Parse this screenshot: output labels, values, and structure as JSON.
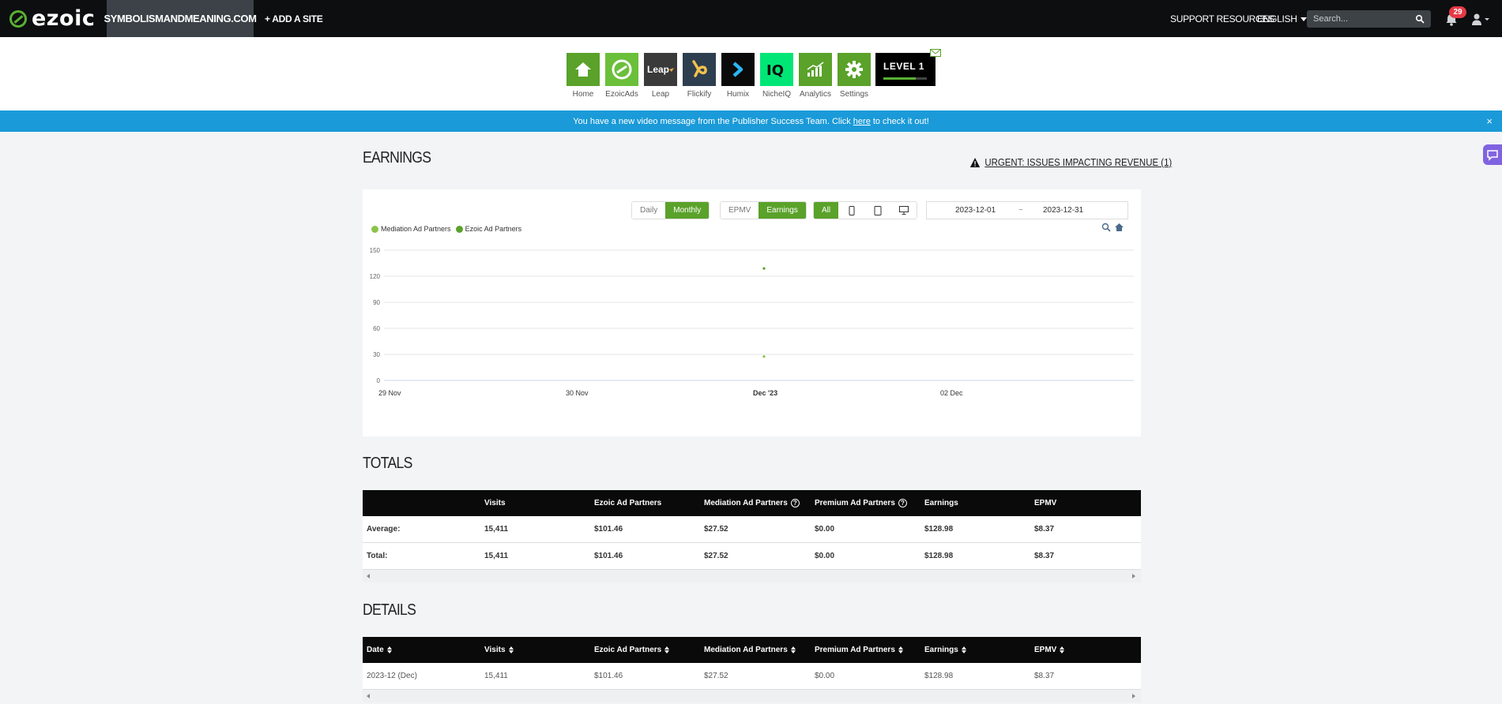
{
  "brand": {
    "name": "ezoic"
  },
  "topbar": {
    "site": "SYMBOLISMANDMEANING.COM",
    "add_site": "+ ADD A SITE",
    "support": "SUPPORT RESOURCES",
    "language": "ENGLISH",
    "search_placeholder": "Search...",
    "notification_count": "29"
  },
  "apps": [
    {
      "label": "Home",
      "color": "#5aa22a",
      "icon": "home-icon"
    },
    {
      "label": "EzoicAds",
      "color": "#5aa22a",
      "icon": "ezoicads-icon"
    },
    {
      "label": "Leap",
      "color": "#3a3a3a",
      "icon": "leap-icon"
    },
    {
      "label": "Flickify",
      "color": "#2d3e4f",
      "icon": "flickify-icon"
    },
    {
      "label": "Humix",
      "color": "#0a0a0a",
      "icon": "humix-icon"
    },
    {
      "label": "NicheIQ",
      "color": "#00e676",
      "icon": "nicheiq-icon"
    },
    {
      "label": "Analytics",
      "color": "#5aa22a",
      "icon": "analytics-icon"
    },
    {
      "label": "Settings",
      "color": "#5aa22a",
      "icon": "gear-icon"
    }
  ],
  "level": {
    "text": "LEVEL 1",
    "progress": 0.75
  },
  "banner": {
    "before": "You have a new video message from the Publisher Success Team. Click",
    "link": "here",
    "after": "to check it out!",
    "close": "×"
  },
  "earnings": {
    "title": "EARNINGS",
    "urgent": "URGENT: ISSUES IMPACTING REVENUE (1)",
    "period_buttons": [
      "Daily",
      "Monthly"
    ],
    "active_period": "Monthly",
    "metric_buttons": [
      "EPMV",
      "Earnings"
    ],
    "active_metric": "Earnings",
    "device_all": "All",
    "date_from": "2023-12-01",
    "date_sep": "~",
    "date_to": "2023-12-31"
  },
  "chart_data": {
    "type": "scatter",
    "x": [
      "29 Nov",
      "30 Nov",
      "Dec '23",
      "02 Dec"
    ],
    "series": [
      {
        "name": "Mediation Ad Partners",
        "color": "#8bc34a",
        "points": [
          {
            "x": "Dec '23",
            "y": 27.52
          }
        ]
      },
      {
        "name": "Ezoic Ad Partners",
        "color": "#5aa22a",
        "points": [
          {
            "x": "Dec '23",
            "y": 128.98
          }
        ]
      }
    ],
    "yticks": [
      0,
      30,
      60,
      90,
      120,
      150
    ],
    "ylim": [
      0,
      150
    ],
    "grid": true,
    "legend": "top-left"
  },
  "totals": {
    "title": "TOTALS",
    "columns": [
      "",
      "Visits",
      "Ezoic Ad Partners",
      "Mediation Ad Partners",
      "Premium Ad Partners",
      "Earnings",
      "EPMV"
    ],
    "rows": [
      [
        "Average:",
        "15,411",
        "$101.46",
        "$27.52",
        "$0.00",
        "$128.98",
        "$8.37"
      ],
      [
        "Total:",
        "15,411",
        "$101.46",
        "$27.52",
        "$0.00",
        "$128.98",
        "$8.37"
      ]
    ]
  },
  "details": {
    "title": "DETAILS",
    "columns": [
      "Date",
      "Visits",
      "Ezoic Ad Partners",
      "Mediation Ad Partners",
      "Premium Ad Partners",
      "Earnings",
      "EPMV"
    ],
    "rows": [
      [
        "2023-12 (Dec)",
        "15,411",
        "$101.46",
        "$27.52",
        "$0.00",
        "$128.98",
        "$8.37"
      ]
    ]
  }
}
